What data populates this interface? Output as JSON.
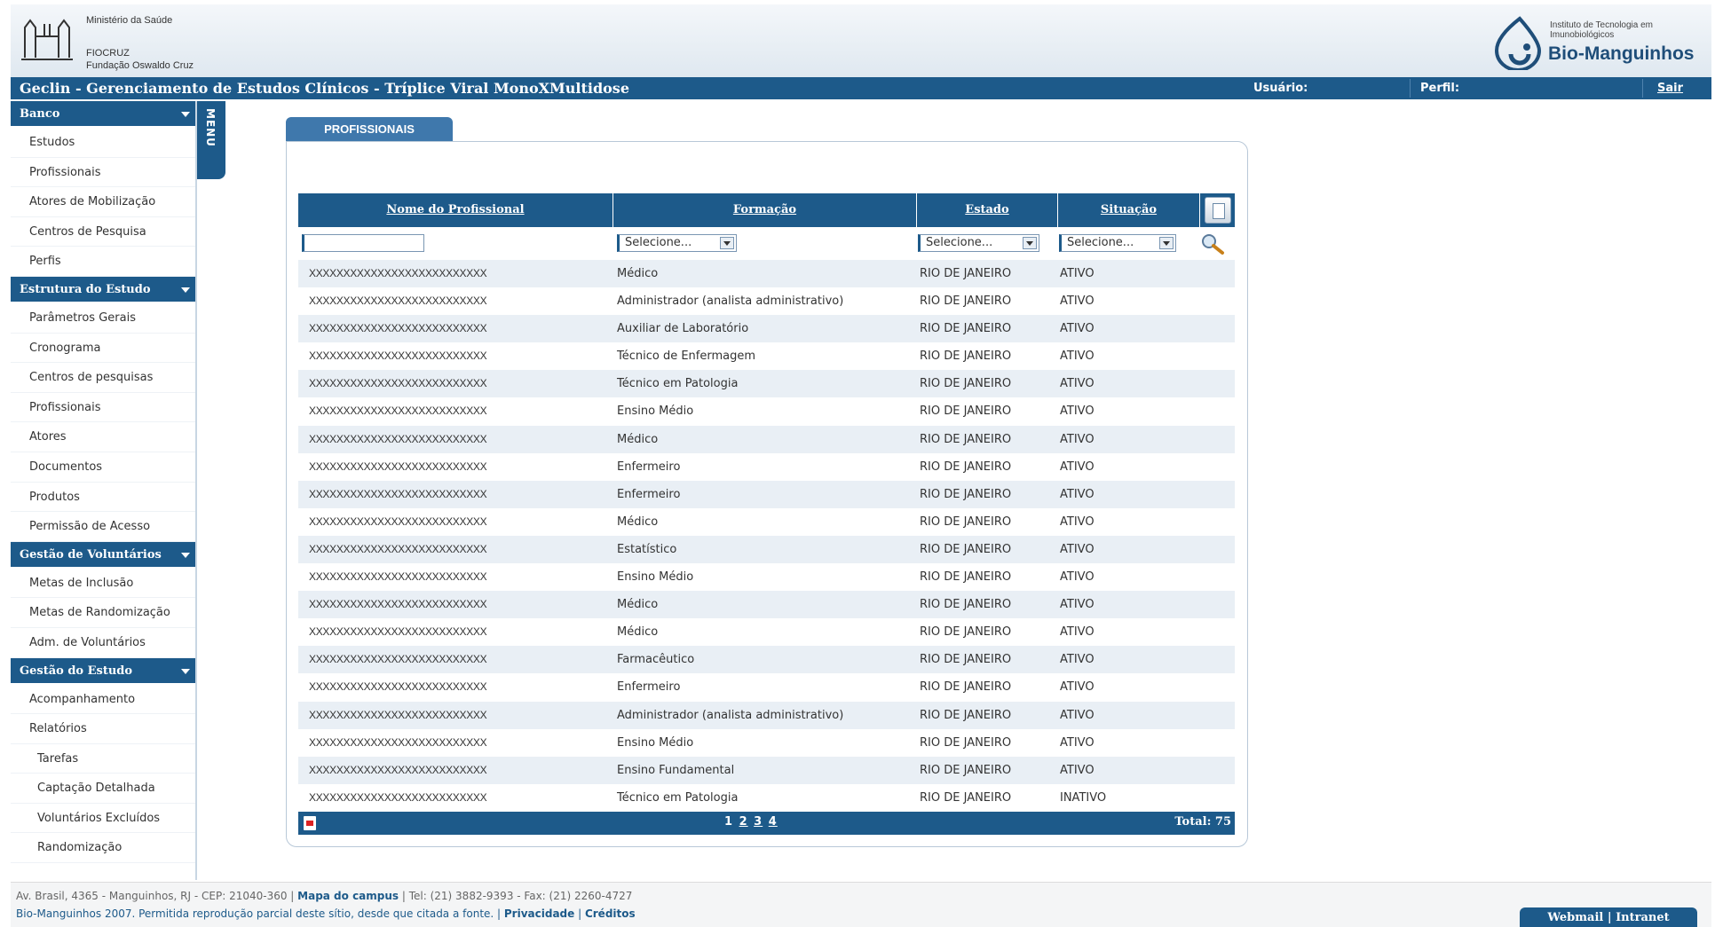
{
  "header": {
    "ministerio": "Ministério da Saúde",
    "fiocruz_line1": "FIOCRUZ",
    "fiocruz_line2": "Fundação Oswaldo Cruz",
    "bio_institute": "Instituto de Tecnologia em Imunobiológicos",
    "bio_name": "Bio-Manguinhos"
  },
  "titlebar": {
    "title": "Geclin - Gerenciamento de Estudos Clínicos  - Tríplice Viral MonoXMultidose",
    "usuario_label": "Usuário:",
    "perfil_label": "Perfil:",
    "sair_label": "Sair"
  },
  "menu_tab": "MENU",
  "sidebar": {
    "sections": [
      {
        "title": "Banco",
        "items": [
          "Estudos",
          "Profissionais",
          "Atores de Mobilização",
          "Centros de Pesquisa",
          "Perfis"
        ]
      },
      {
        "title": "Estrutura do Estudo",
        "items": [
          "Parâmetros Gerais",
          "Cronograma",
          "Centros de pesquisas",
          "Profissionais",
          "Atores",
          "Documentos",
          "Produtos",
          "Permissão de Acesso"
        ]
      },
      {
        "title": "Gestão de Voluntários",
        "items": [
          "Metas de Inclusão",
          "Metas de Randomização",
          "Adm. de Voluntários"
        ]
      },
      {
        "title": "Gestão do Estudo",
        "items": [
          "Acompanhamento",
          "Relatórios"
        ],
        "subitems": [
          "Tarefas",
          "Captação Detalhada",
          "Voluntários Excluídos",
          "Randomização"
        ]
      }
    ]
  },
  "panel": {
    "tab_label": "PROFISSIONAIS",
    "columns": {
      "nome": "Nome do Profissional",
      "formacao": "Formação",
      "estado": "Estado",
      "situacao": "Situação"
    },
    "filters": {
      "formacao": "Selecione...",
      "estado": "Selecione...",
      "situacao": "Selecione..."
    },
    "rows": [
      [
        "XXXXXXXXXXXXXXXXXXXXXXXXXX",
        "Médico",
        "RIO DE JANEIRO",
        "ATIVO"
      ],
      [
        "XXXXXXXXXXXXXXXXXXXXXXXXXX",
        "Administrador (analista administrativo)",
        "RIO DE JANEIRO",
        "ATIVO"
      ],
      [
        "XXXXXXXXXXXXXXXXXXXXXXXXXX",
        "Auxiliar de Laboratório",
        "RIO DE JANEIRO",
        "ATIVO"
      ],
      [
        "XXXXXXXXXXXXXXXXXXXXXXXXXX",
        "Técnico de Enfermagem",
        "RIO DE JANEIRO",
        "ATIVO"
      ],
      [
        "XXXXXXXXXXXXXXXXXXXXXXXXXX",
        "Técnico em Patologia",
        "RIO DE JANEIRO",
        "ATIVO"
      ],
      [
        "XXXXXXXXXXXXXXXXXXXXXXXXXX",
        "Ensino Médio",
        "RIO DE JANEIRO",
        "ATIVO"
      ],
      [
        "XXXXXXXXXXXXXXXXXXXXXXXXXX",
        "Médico",
        "RIO DE JANEIRO",
        "ATIVO"
      ],
      [
        "XXXXXXXXXXXXXXXXXXXXXXXXXX",
        "Enfermeiro",
        "RIO DE JANEIRO",
        "ATIVO"
      ],
      [
        "XXXXXXXXXXXXXXXXXXXXXXXXXX",
        "Enfermeiro",
        "RIO DE JANEIRO",
        "ATIVO"
      ],
      [
        "XXXXXXXXXXXXXXXXXXXXXXXXXX",
        "Médico",
        "RIO DE JANEIRO",
        "ATIVO"
      ],
      [
        "XXXXXXXXXXXXXXXXXXXXXXXXXX",
        "Estatístico",
        "RIO DE JANEIRO",
        "ATIVO"
      ],
      [
        "XXXXXXXXXXXXXXXXXXXXXXXXXX",
        "Ensino Médio",
        "RIO DE JANEIRO",
        "ATIVO"
      ],
      [
        "XXXXXXXXXXXXXXXXXXXXXXXXXX",
        "Médico",
        "RIO DE JANEIRO",
        "ATIVO"
      ],
      [
        "XXXXXXXXXXXXXXXXXXXXXXXXXX",
        "Médico",
        "RIO DE JANEIRO",
        "ATIVO"
      ],
      [
        "XXXXXXXXXXXXXXXXXXXXXXXXXX",
        "Farmacêutico",
        "RIO DE JANEIRO",
        "ATIVO"
      ],
      [
        "XXXXXXXXXXXXXXXXXXXXXXXXXX",
        "Enfermeiro",
        "RIO DE JANEIRO",
        "ATIVO"
      ],
      [
        "XXXXXXXXXXXXXXXXXXXXXXXXXX",
        "Administrador (analista administrativo)",
        "RIO DE JANEIRO",
        "ATIVO"
      ],
      [
        "XXXXXXXXXXXXXXXXXXXXXXXXXX",
        "Ensino Médio",
        "RIO DE JANEIRO",
        "ATIVO"
      ],
      [
        "XXXXXXXXXXXXXXXXXXXXXXXXXX",
        "Ensino Fundamental",
        "RIO DE JANEIRO",
        "ATIVO"
      ],
      [
        "XXXXXXXXXXXXXXXXXXXXXXXXXX",
        "Técnico em Patologia",
        "RIO DE JANEIRO",
        "INATIVO"
      ]
    ],
    "pages": [
      "1",
      "2",
      "3",
      "4"
    ],
    "total": "Total: 75"
  },
  "footer": {
    "line1_address": "Av. Brasil, 4365 - Manguinhos, RJ - CEP: 21040-360 | ",
    "line1_map": "Mapa do campus",
    "line1_contact": " | Tel: (21) 3882-9393 - Fax: (21) 2260-4727",
    "line2_copy": "Bio-Manguinhos 2007. Permitida reprodução parcial deste sítio, desde que citada a fonte. | ",
    "line2_privacy": "Privacidade",
    "line2_sep": " | ",
    "line2_credits": "Créditos",
    "webmail": "Webmail | Intranet"
  },
  "colors": {
    "primary": "#1d5a8a",
    "row_alt": "#e9eff5"
  },
  "icons": [
    "fiocruz-logo-icon",
    "bio-manguinhos-logo-icon",
    "chevron-down-icon",
    "export-icon",
    "search-icon",
    "pdf-icon"
  ]
}
